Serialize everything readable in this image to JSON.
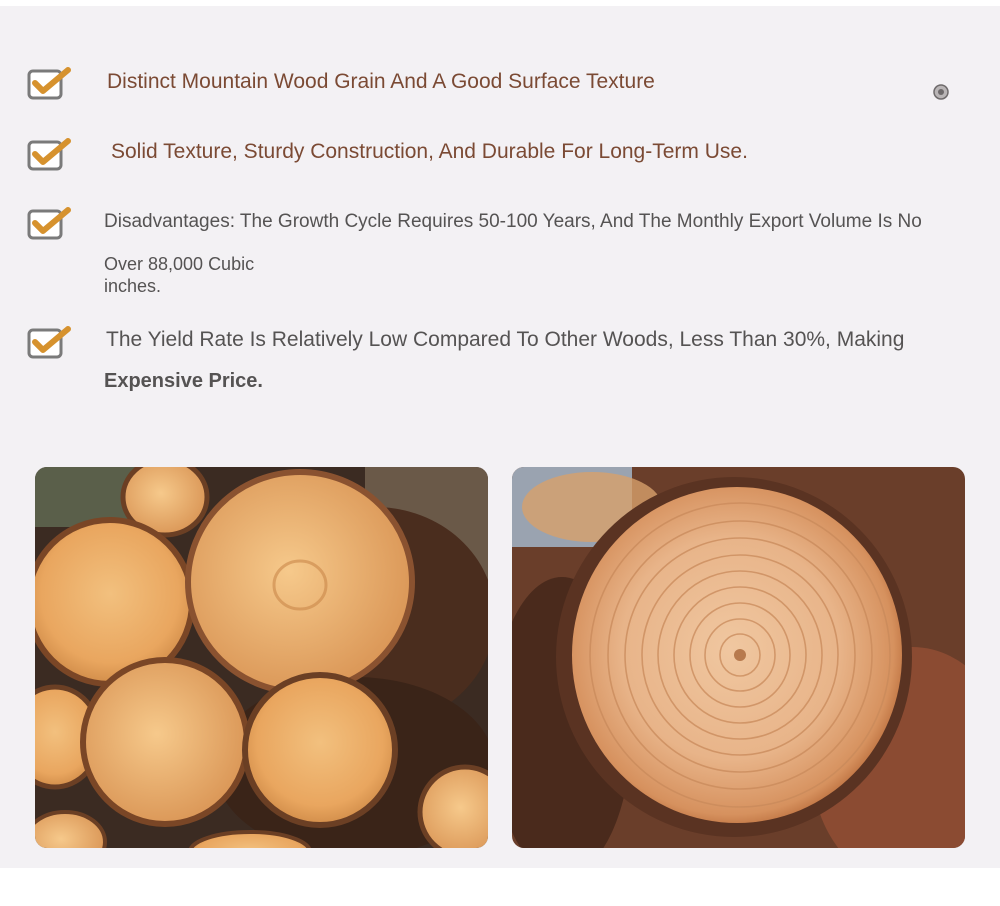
{
  "features": [
    {
      "text": "Distinct Mountain Wood Grain And A Good Surface Texture",
      "icon": "checkbox-checked-icon"
    },
    {
      "text": "Solid Texture, Sturdy Construction, And Durable For Long-Term Use.",
      "icon": "checkbox-checked-icon"
    },
    {
      "text": "Disadvantages: The Growth Cycle Requires 50-100 Years, And The Monthly Export Volume Is No",
      "continuation": "Over 88,000 Cubic inches.",
      "icon": "checkbox-checked-icon"
    },
    {
      "text": "The Yield Rate Is Relatively Low Compared To Other Woods, Less Than 30%, Making",
      "continuation": "Expensive Price.",
      "icon": "checkbox-checked-icon"
    }
  ],
  "images": [
    {
      "subject": "stacked-logs-photo"
    },
    {
      "subject": "log-cross-section-photo"
    }
  ],
  "colors": {
    "accent_check": "#d6922e",
    "box_border": "#7a7a7a",
    "heading_brown": "#7b4a34",
    "body_gray": "#555353",
    "panel_bg": "#f3f1f4"
  }
}
